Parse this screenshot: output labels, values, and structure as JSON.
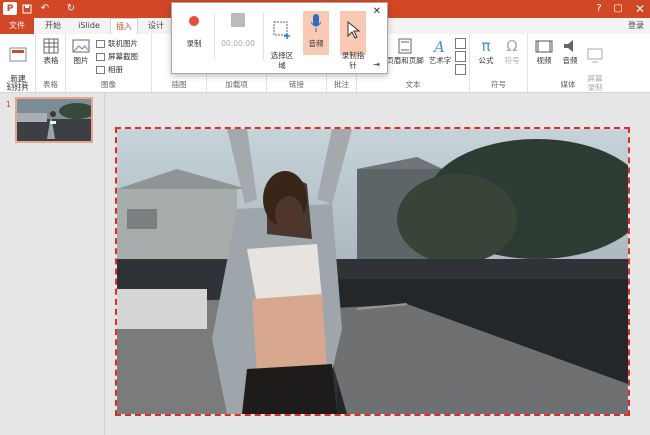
{
  "titlebar": {
    "win_help": "?",
    "win_max": "▢",
    "win_close": "✕",
    "app_icon": "P"
  },
  "tabs": {
    "file": "文件",
    "home": "开始",
    "islide": "iSlide",
    "insert": "插入",
    "design": "设计",
    "login": "登录"
  },
  "ribbon": {
    "new_slide": "新建\n幻灯片",
    "group_slides": "幻灯片",
    "table": "表格",
    "group_table": "表格",
    "picture": "图片",
    "online_picture": "联机图片",
    "screenshot": "屏幕截图",
    "album": "相册",
    "group_images": "图像",
    "group_illustrations": "插图",
    "group_addins": "加载项",
    "group_links": "链接",
    "group_comments": "批注",
    "header_footer": "页眉和页脚",
    "wordart": "艺术字",
    "group_text": "文本",
    "equation": "公式",
    "symbol": "符号",
    "group_symbols": "符号",
    "video": "视频",
    "audio": "音频",
    "screen_record": "屏幕\n录制",
    "group_media": "媒体"
  },
  "record_dialog": {
    "record": "录制",
    "time": "00:00:00",
    "select_area": "选择区\n域",
    "audio": "音频",
    "record_pointer": "录制指\n针",
    "close": "✕",
    "pin": "⇥"
  },
  "thumbnails": {
    "slide_number": "1"
  },
  "colors": {
    "accent": "#d24726",
    "selection": "#e22b27",
    "record_red": "#e74c3c",
    "highlight": "#f9c9b4"
  },
  "icons": [
    "powerpoint-icon",
    "save-icon",
    "undo-icon",
    "redo-icon",
    "table-icon",
    "picture-icon",
    "mic-icon",
    "cursor-icon",
    "pi-icon",
    "omega-icon",
    "video-icon",
    "speaker-icon",
    "stop-icon"
  ]
}
